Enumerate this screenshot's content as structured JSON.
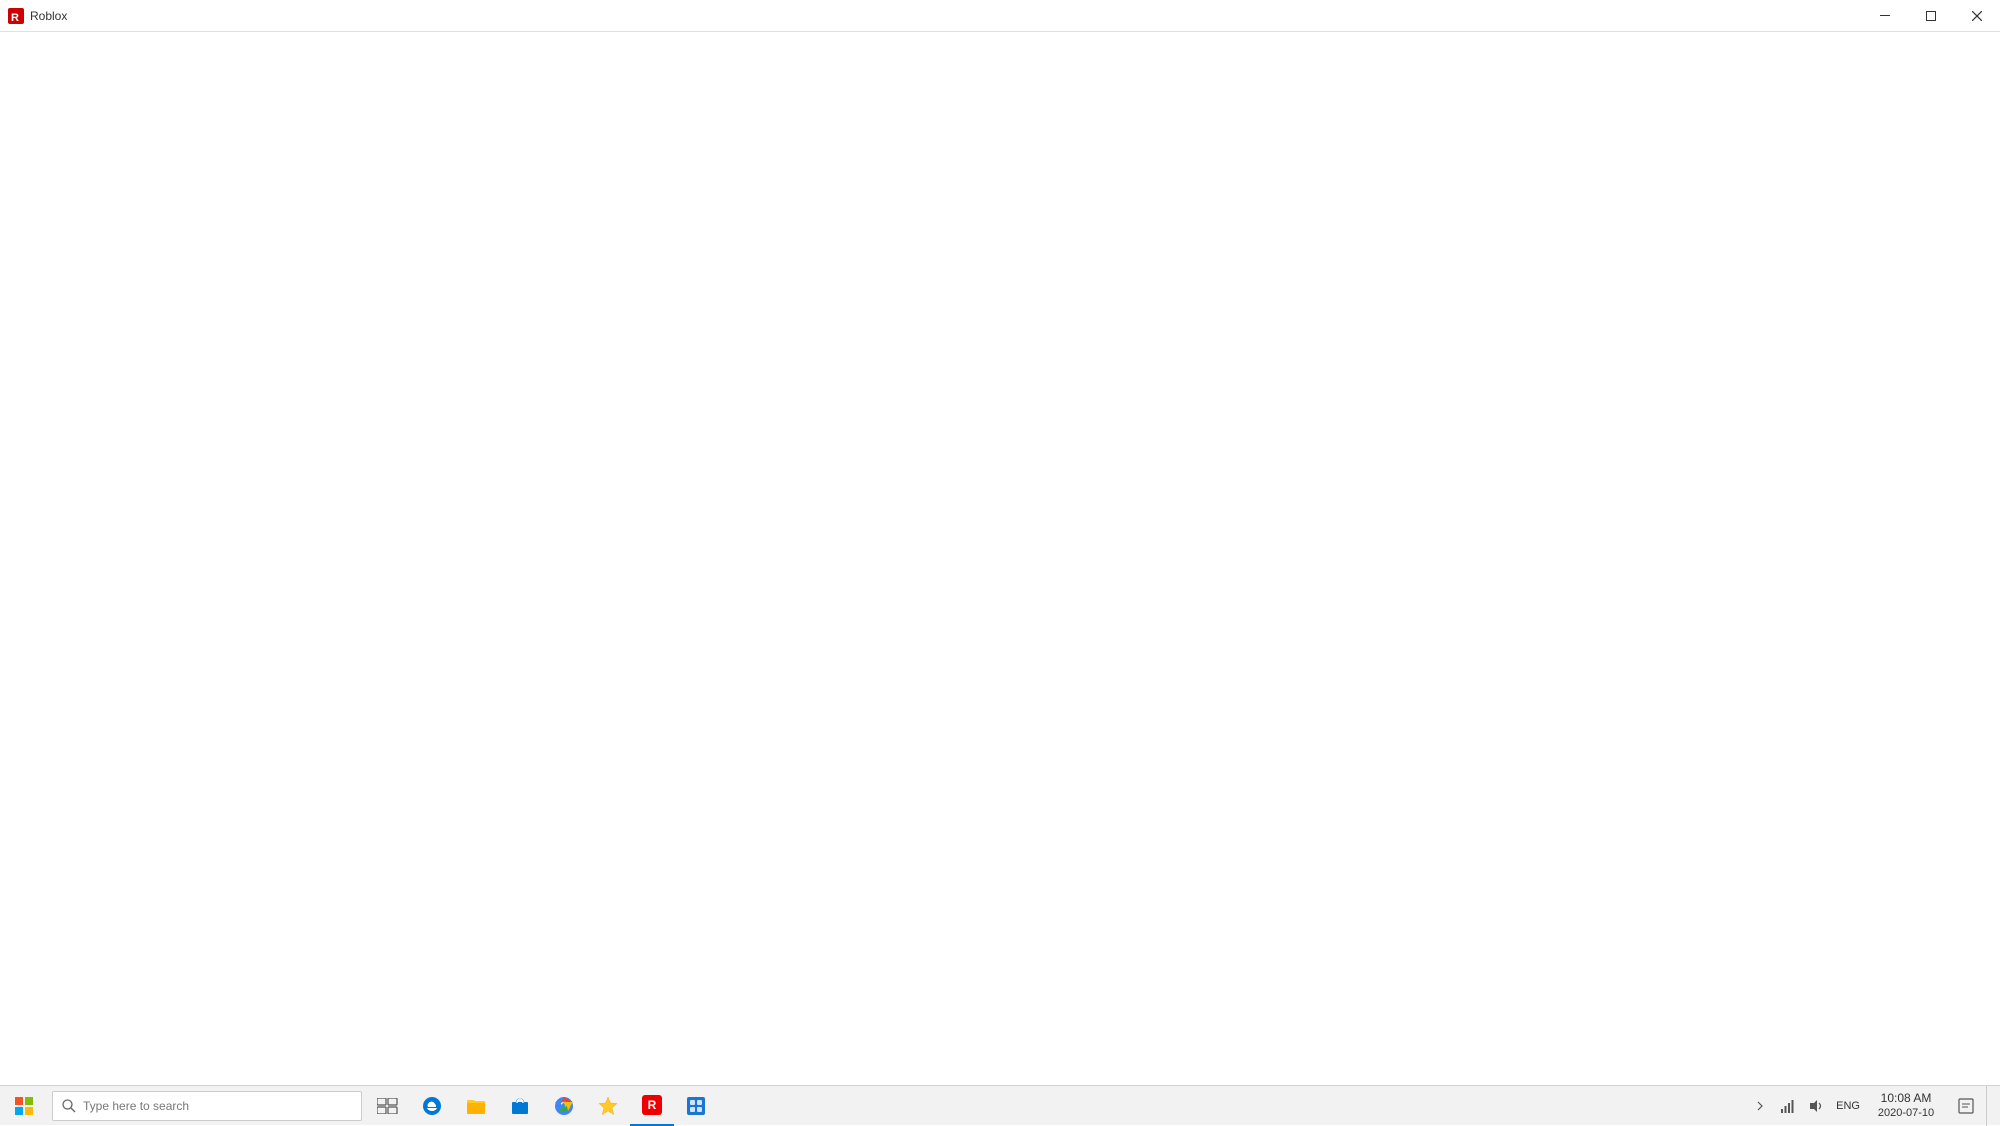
{
  "titlebar": {
    "title": "Roblox",
    "minimize_label": "Minimize",
    "restore_label": "Restore",
    "close_label": "Close"
  },
  "main": {
    "background": "#ffffff"
  },
  "taskbar": {
    "search_placeholder": "Type here to search",
    "clock": {
      "time": "10:08 AM",
      "date": "2020-07-10"
    },
    "language": "ENG",
    "apps": [
      {
        "name": "Microsoft Edge",
        "id": "edge"
      },
      {
        "name": "File Explorer",
        "id": "file-explorer"
      },
      {
        "name": "Microsoft Store",
        "id": "store"
      },
      {
        "name": "Google Chrome",
        "id": "chrome"
      },
      {
        "name": "Bookmarks",
        "id": "bookmarks"
      },
      {
        "name": "Roblox",
        "id": "roblox"
      },
      {
        "name": "App 7",
        "id": "app7"
      }
    ]
  }
}
